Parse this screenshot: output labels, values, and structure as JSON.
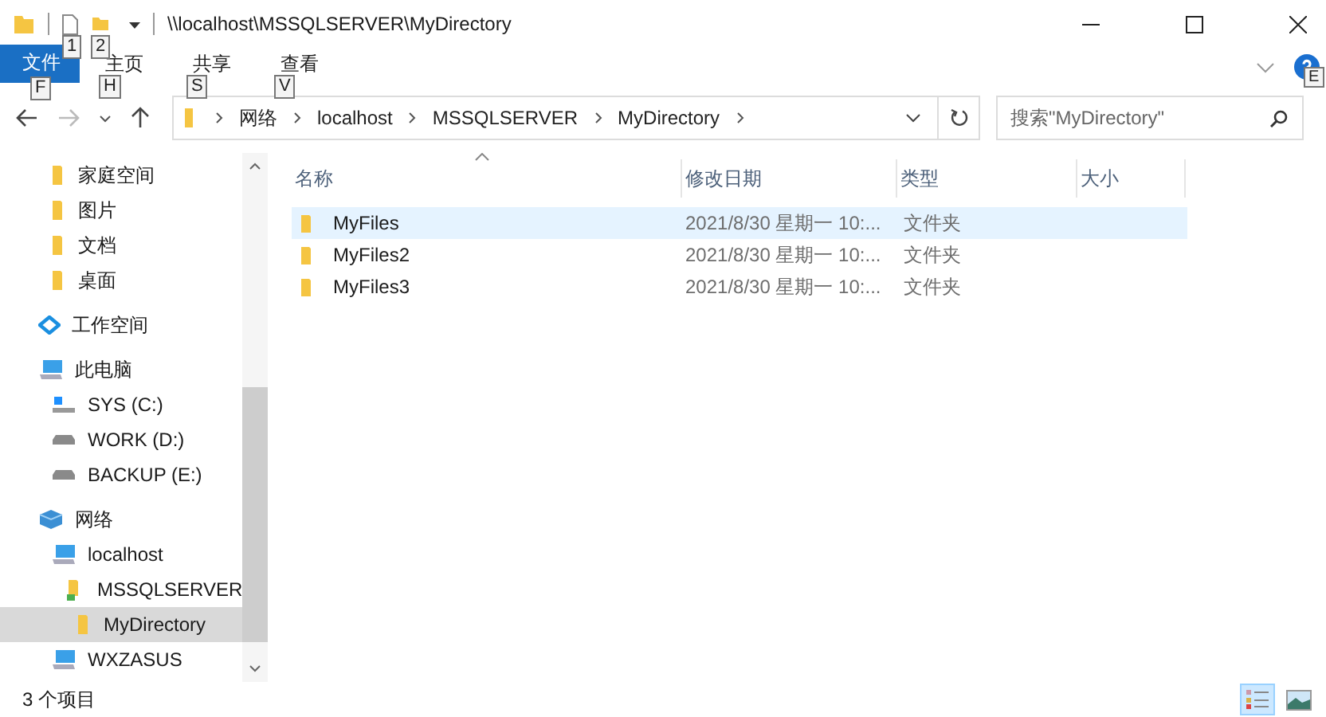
{
  "title_bar": {
    "path": "\\\\localhost\\MSSQLSERVER\\MyDirectory",
    "keytips": [
      "1",
      "2"
    ]
  },
  "ribbon": {
    "tabs": [
      {
        "label": "文件",
        "keytip": "F",
        "selected": true
      },
      {
        "label": "主页",
        "keytip": "H",
        "selected": false
      },
      {
        "label": "共享",
        "keytip": "S",
        "selected": false
      },
      {
        "label": "查看",
        "keytip": "V",
        "selected": false
      }
    ],
    "help_keytip": "E"
  },
  "address_bar": {
    "segments": [
      "网络",
      "localhost",
      "MSSQLSERVER",
      "MyDirectory"
    ]
  },
  "search": {
    "placeholder": "搜索\"MyDirectory\""
  },
  "sidebar": {
    "sections": [
      {
        "kind": "pinned",
        "items": [
          {
            "label": "家庭空间",
            "kind": "folder",
            "selected": false
          },
          {
            "label": "图片",
            "kind": "folder",
            "selected": false
          },
          {
            "label": "文档",
            "kind": "folder",
            "selected": false
          },
          {
            "label": "桌面",
            "kind": "folder",
            "selected": false
          }
        ]
      },
      {
        "kind": "tree",
        "items": [
          {
            "label": "工作空间",
            "kind": "workspace",
            "selected": false
          }
        ]
      },
      {
        "kind": "tree",
        "items": [
          {
            "label": "此电脑",
            "kind": "pc",
            "selected": false,
            "children": [
              {
                "label": "SYS (C:)",
                "kind": "sysdrive",
                "selected": false
              },
              {
                "label": "WORK (D:)",
                "kind": "drive",
                "selected": false
              },
              {
                "label": "BACKUP (E:)",
                "kind": "drive",
                "selected": false
              }
            ]
          }
        ]
      },
      {
        "kind": "tree",
        "items": [
          {
            "label": "网络",
            "kind": "network",
            "selected": false,
            "children": [
              {
                "label": "localhost",
                "kind": "pc",
                "selected": false,
                "children": [
                  {
                    "label": "MSSQLSERVER",
                    "kind": "share",
                    "selected": false,
                    "children": [
                      {
                        "label": "MyDirectory",
                        "kind": "folder",
                        "selected": true
                      }
                    ]
                  }
                ]
              },
              {
                "label": "WXZASUS",
                "kind": "pc",
                "selected": false
              }
            ]
          }
        ]
      }
    ]
  },
  "table": {
    "columns": [
      "名称",
      "修改日期",
      "类型",
      "大小"
    ],
    "rows": [
      {
        "name": "MyFiles",
        "date": "2021/8/30 星期一 10:...",
        "type": "文件夹",
        "selected": true
      },
      {
        "name": "MyFiles2",
        "date": "2021/8/30 星期一 10:...",
        "type": "文件夹",
        "selected": false
      },
      {
        "name": "MyFiles3",
        "date": "2021/8/30 星期一 10:...",
        "type": "文件夹",
        "selected": false
      }
    ]
  },
  "status_bar": {
    "count": "3 个项目",
    "views": [
      {
        "kind": "details",
        "selected": true
      },
      {
        "kind": "large-icons",
        "selected": false
      }
    ]
  }
}
